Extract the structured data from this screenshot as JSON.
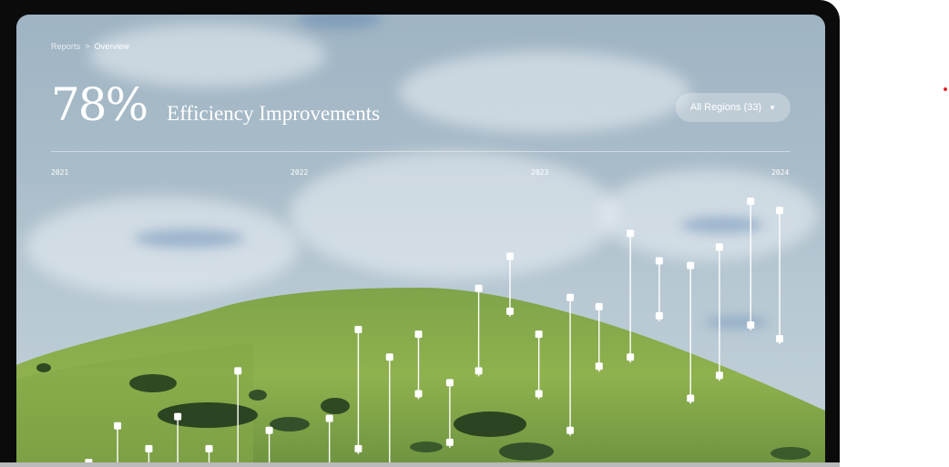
{
  "breadcrumb": {
    "parent": "Reports",
    "separator": ">",
    "current": "Overview"
  },
  "headline": {
    "value": "78%",
    "title": "Efficiency Improvements"
  },
  "region_filter": {
    "label": "All Regions (33)",
    "icon": "chevron-down-icon"
  },
  "timeline": {
    "years": [
      "2021",
      "2022",
      "2023",
      "2024"
    ]
  },
  "colors": {
    "marker": "#ffffff",
    "accent_dot": "#e0242b"
  },
  "chart_data": {
    "type": "range",
    "x_ticks": [
      "2021",
      "2022",
      "2023",
      "2024"
    ],
    "xlim": [
      2021,
      2024
    ],
    "series": [
      {
        "values": [
          {
            "x": 2021.13,
            "low": 0.0,
            "high": 0.0
          },
          {
            "x": 2021.25,
            "low": 0.0,
            "high": 0.4
          },
          {
            "x": 2021.38,
            "low": 0.0,
            "high": 0.15
          },
          {
            "x": 2021.5,
            "low": 0.0,
            "high": 0.5
          },
          {
            "x": 2021.63,
            "low": 0.0,
            "high": 0.15
          },
          {
            "x": 2021.75,
            "low": 0.0,
            "high": 1.0
          },
          {
            "x": 2021.88,
            "low": 0.0,
            "high": 0.35
          },
          {
            "x": 2022.13,
            "low": 0.0,
            "high": 0.48
          },
          {
            "x": 2022.25,
            "low": 0.15,
            "high": 1.45
          },
          {
            "x": 2022.38,
            "low": 0.0,
            "high": 1.15
          },
          {
            "x": 2022.5,
            "low": 0.75,
            "high": 1.4
          },
          {
            "x": 2022.63,
            "low": 0.22,
            "high": 0.87
          },
          {
            "x": 2022.75,
            "low": 1.0,
            "high": 1.9
          },
          {
            "x": 2022.88,
            "low": 1.65,
            "high": 2.25
          },
          {
            "x": 2023.0,
            "low": 0.75,
            "high": 1.4
          },
          {
            "x": 2023.13,
            "low": 0.35,
            "high": 1.8
          },
          {
            "x": 2023.25,
            "low": 1.05,
            "high": 1.7
          },
          {
            "x": 2023.38,
            "low": 1.15,
            "high": 2.5
          },
          {
            "x": 2023.5,
            "low": 1.6,
            "high": 2.2
          },
          {
            "x": 2023.63,
            "low": 0.7,
            "high": 2.15
          },
          {
            "x": 2023.75,
            "low": 0.95,
            "high": 2.35
          },
          {
            "x": 2023.88,
            "low": 1.5,
            "high": 2.85
          },
          {
            "x": 2024.0,
            "low": 1.35,
            "high": 2.75
          }
        ]
      }
    ],
    "ylim": [
      0,
      3
    ],
    "grid": false,
    "legend": "none"
  }
}
